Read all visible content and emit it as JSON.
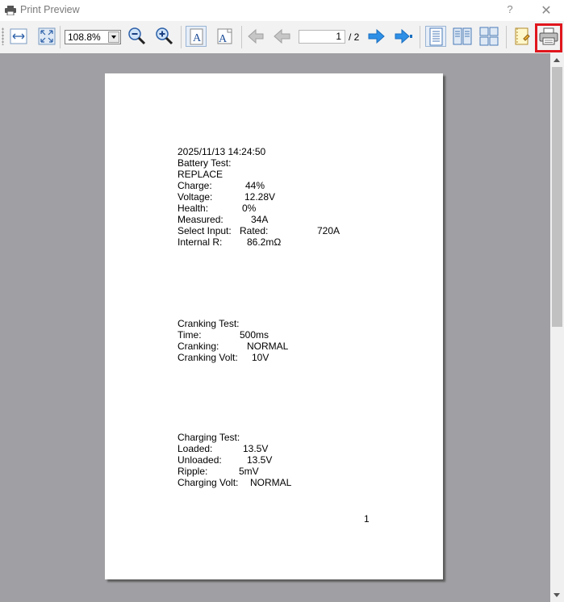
{
  "window": {
    "title": "Print Preview",
    "help": "?",
    "close": "✕"
  },
  "toolbar": {
    "zoom_value": "108.8%",
    "page_current": "1",
    "page_total": "/ 2"
  },
  "page": {
    "battery": {
      "timestamp": "2025/11/13 14:24:50",
      "heading": "Battery Test:",
      "result": "REPLACE",
      "rows": [
        {
          "label": "Charge:",
          "value": "44%"
        },
        {
          "label": "Voltage:",
          "value": "12.28V"
        },
        {
          "label": "Health:",
          "value": "0%"
        },
        {
          "label": "Measured:",
          "value": "34A"
        }
      ],
      "select_input": {
        "label": "Select Input:",
        "rated_label": "Rated:",
        "rated_value": "720A"
      },
      "internal_r": {
        "label": "Internal R:",
        "value": "86.2mΩ"
      }
    },
    "cranking": {
      "heading": "Cranking Test:",
      "rows": [
        {
          "label": "Time:",
          "value": "500ms"
        },
        {
          "label": "Cranking:",
          "value": "NORMAL"
        },
        {
          "label": "Cranking Volt:",
          "value": "10V"
        }
      ]
    },
    "charging": {
      "heading": "Charging Test:",
      "rows": [
        {
          "label": "Loaded:",
          "value": "13.5V"
        },
        {
          "label": "Unloaded:",
          "value": "13.5V"
        },
        {
          "label": "Ripple:",
          "value": "5mV"
        },
        {
          "label": "Charging Volt:",
          "value": "NORMAL"
        }
      ]
    },
    "page_number": "1"
  },
  "colors": {
    "highlight": "#e0161d",
    "preview_bg": "#a0a0a4",
    "arrow_blue": "#2e8fe6"
  }
}
